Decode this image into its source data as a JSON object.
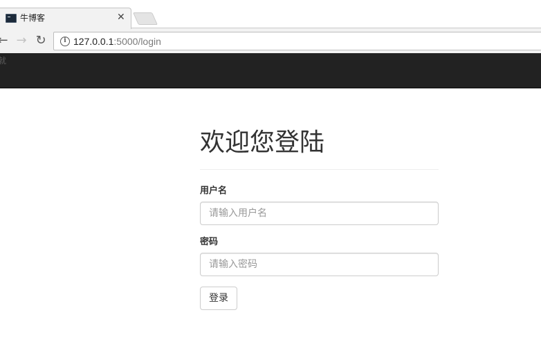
{
  "browser": {
    "tab": {
      "title": "牛博客",
      "close_glyph": "✕",
      "icon": "terminal-favicon"
    },
    "nav": {
      "back_glyph": "←",
      "forward_glyph": "→",
      "reload_glyph": "↻"
    },
    "address": {
      "host": "127.0.0.1",
      "rest": ":5000/login",
      "info_glyph": "i"
    }
  },
  "navbar": {
    "brand": "就"
  },
  "login": {
    "title": "欢迎您登陆",
    "username_label": "用户名",
    "username_placeholder": "请输入用户名",
    "password_label": "密码",
    "password_placeholder": "请输入密码",
    "submit_label": "登录"
  }
}
